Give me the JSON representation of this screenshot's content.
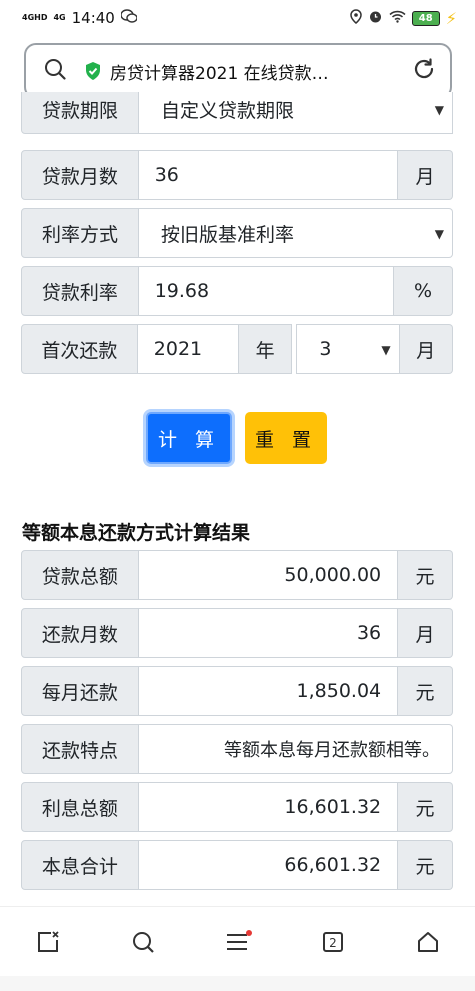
{
  "status_bar": {
    "signal1": "4GHD",
    "signal2": "4G",
    "time": "14:40",
    "battery": "48"
  },
  "browser": {
    "url_title": "房贷计算器2021 在线贷款…"
  },
  "form": {
    "partial_row": {
      "label": "贷款期限",
      "value": "自定义贷款期限"
    },
    "months": {
      "label": "贷款月数",
      "value": "36",
      "unit": "月"
    },
    "rate_method": {
      "label": "利率方式",
      "value": "按旧版基准利率"
    },
    "rate": {
      "label": "贷款利率",
      "value": "19.68",
      "unit": "%"
    },
    "first_payment": {
      "label": "首次还款",
      "year": "2021",
      "year_unit": "年",
      "month": "3",
      "month_unit": "月"
    }
  },
  "buttons": {
    "calculate": "计 算",
    "reset": "重 置"
  },
  "results": {
    "title": "等额本息还款方式计算结果",
    "rows": [
      {
        "label": "贷款总额",
        "value": "50,000.00",
        "unit": "元"
      },
      {
        "label": "还款月数",
        "value": "36",
        "unit": "月"
      },
      {
        "label": "每月还款",
        "value": "1,850.04",
        "unit": "元"
      },
      {
        "label": "还款特点",
        "value": "等额本息每月还款额相等。"
      },
      {
        "label": "利息总额",
        "value": "16,601.32",
        "unit": "元"
      },
      {
        "label": "本息合计",
        "value": "66,601.32",
        "unit": "元"
      }
    ]
  },
  "bottom_nav": {
    "tabs_count": "2"
  },
  "icons": [
    "search-icon",
    "shield-check-icon",
    "refresh-icon",
    "close-page-icon",
    "search-nav-icon",
    "menu-icon",
    "tabs-icon",
    "home-icon"
  ]
}
